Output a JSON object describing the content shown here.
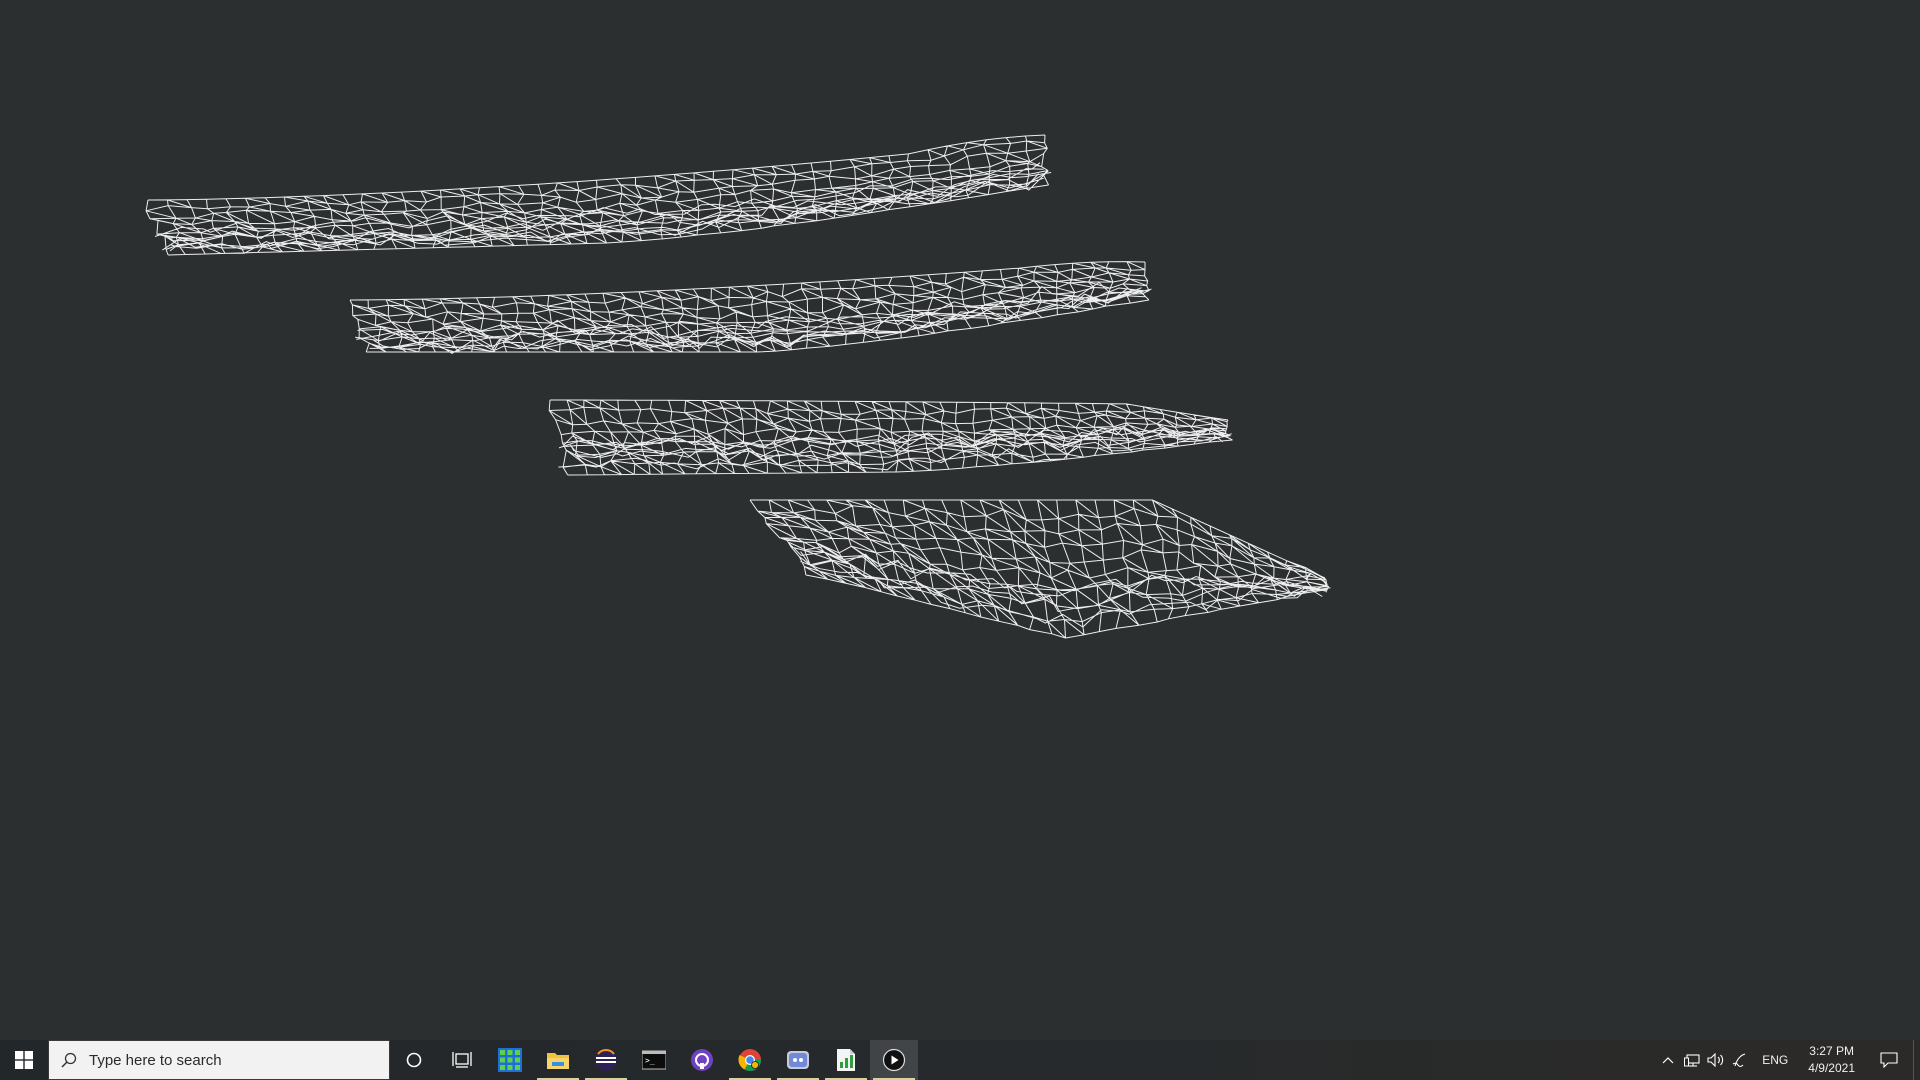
{
  "taskbar": {
    "search_placeholder": "Type here to search",
    "apps": [
      {
        "icon": "cortana-icon",
        "running": false
      },
      {
        "icon": "task-view-icon",
        "running": false
      },
      {
        "icon": "grid-app-icon",
        "running": false
      },
      {
        "icon": "file-explorer-icon",
        "running": true
      },
      {
        "icon": "eclipse-icon",
        "running": true
      },
      {
        "icon": "terminal-icon",
        "running": false
      },
      {
        "icon": "github-desktop-icon",
        "running": false
      },
      {
        "icon": "chrome-icon",
        "running": true
      },
      {
        "icon": "discord-icon",
        "running": true
      },
      {
        "icon": "charts-app-icon",
        "running": true
      },
      {
        "icon": "media-player-icon",
        "running": true,
        "active": true
      }
    ],
    "tray": {
      "language": "ENG",
      "time": "3:27 PM",
      "date": "4/9/2021"
    }
  },
  "viewport": {
    "background": "#2b2f30",
    "wireframe_color": "#ffffff",
    "mesh_count": 4
  }
}
